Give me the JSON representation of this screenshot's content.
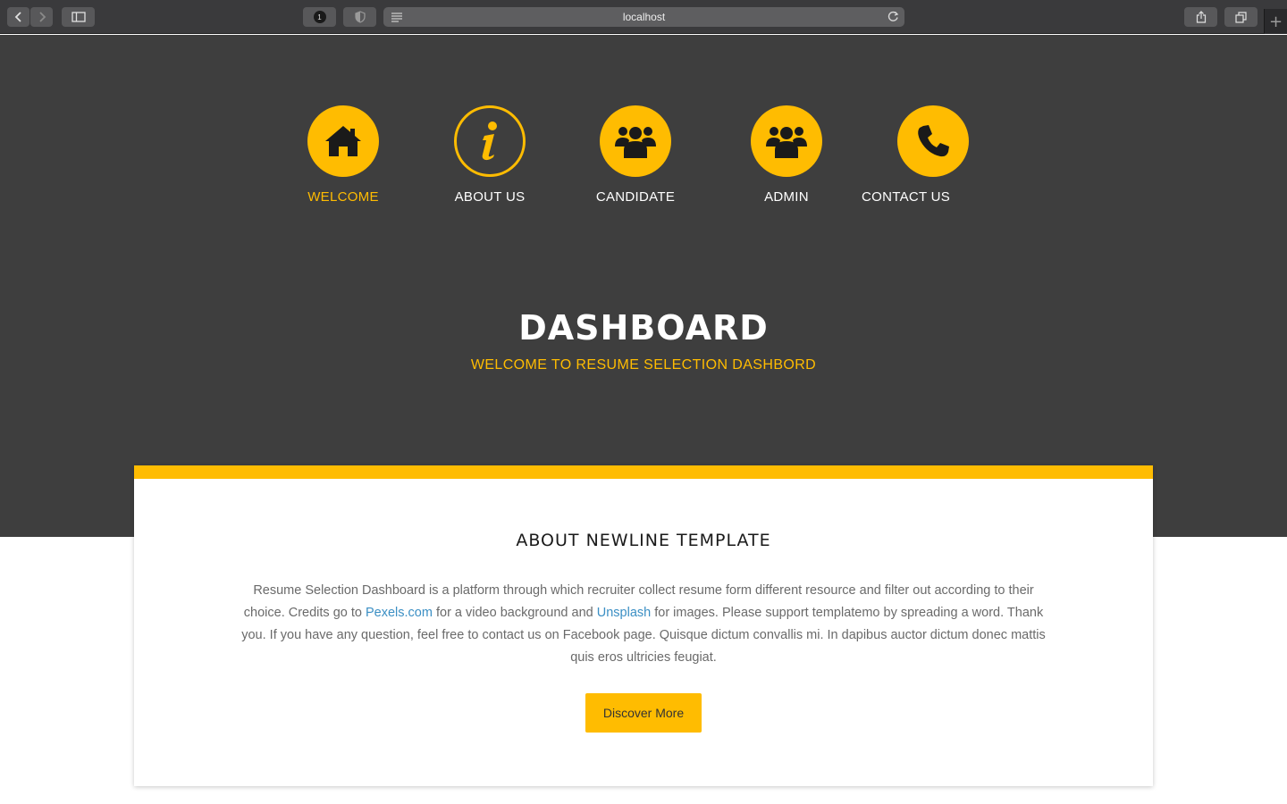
{
  "browser": {
    "url": "localhost",
    "extension_badge": "1"
  },
  "nav": {
    "items": [
      {
        "label": "WELCOME",
        "icon": "home-icon",
        "active": true
      },
      {
        "label": "ABOUT US",
        "icon": "info-icon",
        "active": false
      },
      {
        "label": "CANDIDATE",
        "icon": "users-icon",
        "active": false
      },
      {
        "label": "ADMIN",
        "icon": "users-icon",
        "active": false
      },
      {
        "label": "CONTACT US",
        "icon": "phone-icon",
        "active": false
      }
    ]
  },
  "hero": {
    "title": "DASHBOARD",
    "subtitle": "WELCOME TO RESUME SELECTION DASHBORD"
  },
  "about": {
    "title": "ABOUT NEWLINE TEMPLATE",
    "text_1": "Resume Selection Dashboard is a platform through which recruiter collect resume form different resource and filter out according to their choice. Credits go to ",
    "link_1": "Pexels.com",
    "text_2": " for a video background and ",
    "link_2": "Unsplash",
    "text_3": " for images. Please support templatemo by spreading a word. Thank you. If you have any question, feel free to contact us on Facebook page. Quisque dictum convallis mi. In dapibus auctor dictum donec mattis quis eros ultricies feugiat.",
    "button_label": "Discover More"
  },
  "colors": {
    "accent": "#ffbc01",
    "hero_bg": "#3e3e3e",
    "link": "#3b8fc4"
  }
}
